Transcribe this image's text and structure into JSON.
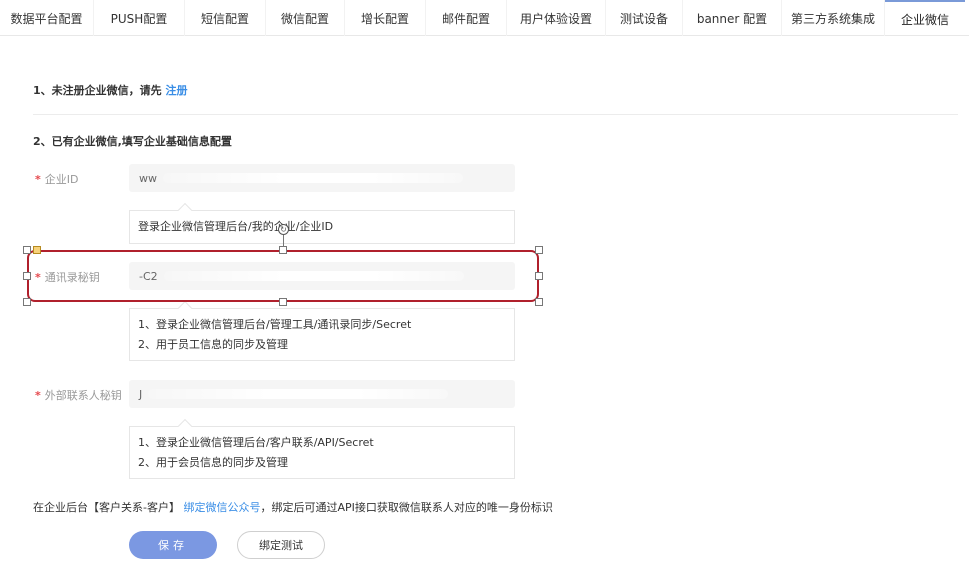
{
  "tabs": [
    {
      "label": "数据平台配置",
      "width": 93
    },
    {
      "label": "PUSH配置",
      "width": 90
    },
    {
      "label": "短信配置",
      "width": 80
    },
    {
      "label": "微信配置",
      "width": 78
    },
    {
      "label": "增长配置",
      "width": 80
    },
    {
      "label": "邮件配置",
      "width": 80
    },
    {
      "label": "用户体验设置",
      "width": 98
    },
    {
      "label": "测试设备",
      "width": 76
    },
    {
      "label": "banner 配置",
      "width": 98
    },
    {
      "label": "第三方系统集成",
      "width": 102
    },
    {
      "label": "企业微信",
      "width": 80
    }
  ],
  "active_tab": "企业微信",
  "section1": {
    "text": "1、未注册企业微信，请先 ",
    "link": "注册"
  },
  "section2": {
    "text": "2、已有企业微信,填写企业基础信息配置"
  },
  "fields": {
    "corp_id": {
      "label": "企业ID",
      "value": "ww",
      "hint": [
        "登录企业微信管理后台/我的企业/企业ID"
      ]
    },
    "contacts_secret": {
      "label": "通讯录秘钥",
      "value": "-C2",
      "hint": [
        "1、登录企业微信管理后台/管理工具/通讯录同步/Secret",
        "2、用于员工信息的同步及管理"
      ]
    },
    "external_secret": {
      "label": "外部联系人秘钥",
      "value": "J",
      "hint": [
        "1、登录企业微信管理后台/客户联系/API/Secret",
        "2、用于会员信息的同步及管理"
      ]
    }
  },
  "footer": {
    "prefix": "在企业后台【客户关系-客户】 ",
    "link": "绑定微信公众号",
    "suffix": "，绑定后可通过API接口获取微信联系人对应的唯一身份标识"
  },
  "buttons": {
    "save": "保存",
    "bind_test": "绑定测试"
  },
  "annotation": {
    "rotate_glyph": "↻"
  },
  "colors": {
    "accent": "#3a8ee6",
    "primary_button": "#7b98e2",
    "annotation": "#b0202c",
    "required": "#e5484d"
  }
}
